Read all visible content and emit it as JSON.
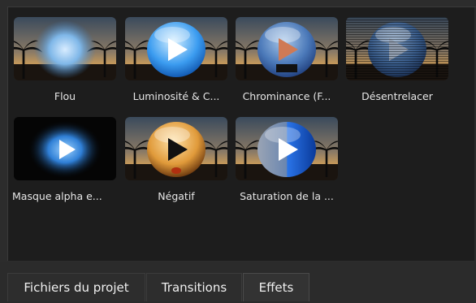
{
  "effects": [
    {
      "label": "Flou",
      "icon": "blur-effect-icon",
      "style": "blur"
    },
    {
      "label": "Luminosité & C...",
      "icon": "brightness-effect-icon",
      "style": "bright"
    },
    {
      "label": "Chrominance (F...",
      "icon": "chroma-key-effect-icon",
      "style": "chroma"
    },
    {
      "label": "Désentrelacer",
      "icon": "deinterlace-effect-icon",
      "style": "deinterlace"
    },
    {
      "label": "Masque alpha e...",
      "icon": "alpha-mask-effect-icon",
      "style": "alpha"
    },
    {
      "label": "Négatif",
      "icon": "negative-effect-icon",
      "style": "negative"
    },
    {
      "label": "Saturation de la ...",
      "icon": "saturation-effect-icon",
      "style": "saturation"
    }
  ],
  "tabs": [
    {
      "label": "Fichiers du projet",
      "active": false
    },
    {
      "label": "Transitions",
      "active": false
    },
    {
      "label": "Effets",
      "active": true
    }
  ],
  "colors": {
    "panel_bg": "#1d1d1d",
    "tab_bg": "#2b2b2b",
    "text": "#e6e6e6"
  }
}
